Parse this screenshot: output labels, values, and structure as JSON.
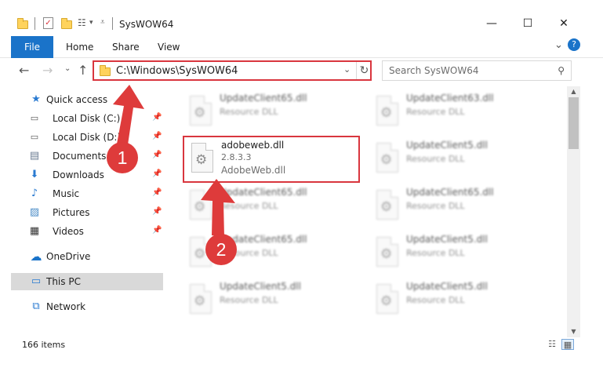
{
  "window": {
    "title": "SysWOW64",
    "min_glyph": "—",
    "max_glyph": "☐",
    "close_glyph": "✕",
    "help_glyph": "?",
    "expand_glyph": "⌄"
  },
  "ribbon": {
    "tabs": [
      "File",
      "Home",
      "Share",
      "View"
    ]
  },
  "address": {
    "path": "C:\\Windows\\SysWOW64",
    "dropdown_glyph": "⌄",
    "refresh_glyph": "↻"
  },
  "search": {
    "placeholder": "Search SysWOW64",
    "icon_glyph": "⚲"
  },
  "nav": {
    "back": "←",
    "forward": "→",
    "recent": "⌄",
    "up": "↑"
  },
  "sidebar": {
    "items": [
      {
        "label": "Quick access",
        "icon": "star-icon",
        "glyph": "★",
        "pinned": false
      },
      {
        "label": "Local Disk (C:)",
        "icon": "drive-icon",
        "glyph": "▭",
        "pinned": true
      },
      {
        "label": "Local Disk (D:)",
        "icon": "drive-icon",
        "glyph": "▭",
        "pinned": true
      },
      {
        "label": "Documents",
        "icon": "documents-icon",
        "glyph": "▤",
        "pinned": true
      },
      {
        "label": "Downloads",
        "icon": "downloads-icon",
        "glyph": "⬇",
        "pinned": true
      },
      {
        "label": "Music",
        "icon": "music-icon",
        "glyph": "♪",
        "pinned": true
      },
      {
        "label": "Pictures",
        "icon": "pictures-icon",
        "glyph": "▨",
        "pinned": true
      },
      {
        "label": "Videos",
        "icon": "videos-icon",
        "glyph": "▦",
        "pinned": true
      },
      {
        "label": "OneDrive",
        "icon": "cloud-icon",
        "glyph": "☁",
        "pinned": false
      },
      {
        "label": "This PC",
        "icon": "computer-icon",
        "glyph": "▭",
        "pinned": false
      },
      {
        "label": "Network",
        "icon": "network-icon",
        "glyph": "⧉",
        "pinned": false
      }
    ],
    "pin_glyph": "📌"
  },
  "files": {
    "highlighted": {
      "name": "adobeweb.dll",
      "version": "2.8.3.3",
      "description": "AdobeWeb.dll"
    },
    "blurred": [
      {
        "name": "UpdateClient65.dll",
        "type": "Resource DLL"
      },
      {
        "name": "UpdateClient63.dll",
        "type": "Resource DLL"
      },
      {
        "name": "UpdateClient5.dll",
        "type": "Resource DLL"
      },
      {
        "name": "UpdateClient65.dll",
        "type": "Resource DLL"
      },
      {
        "name": "UpdateClient65.dll",
        "type": "Resource DLL"
      },
      {
        "name": "UpdateClient65.dll",
        "type": "Resource DLL"
      },
      {
        "name": "UpdateClient5.dll",
        "type": "Resource DLL"
      },
      {
        "name": "UpdateClient5.dll",
        "type": "Resource DLL"
      },
      {
        "name": "UpdateClient5.dll",
        "type": "Resource DLL"
      }
    ],
    "gear_glyph": "⚙"
  },
  "status": {
    "count": "166 items",
    "details_glyph": "☷",
    "tiles_glyph": "▦"
  },
  "annotations": {
    "step1": "1",
    "step2": "2",
    "color": "#de3b3b"
  },
  "colors": {
    "accent": "#1a73c9",
    "highlight": "#d9363e"
  }
}
